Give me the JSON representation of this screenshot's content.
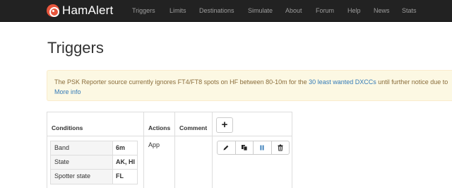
{
  "navbar": {
    "brand": "HamAlert",
    "items": [
      "Triggers",
      "Limits",
      "Destinations",
      "Simulate",
      "About",
      "Forum",
      "Help",
      "News",
      "Stats"
    ]
  },
  "page": {
    "title": "Triggers"
  },
  "alert": {
    "text_before": "The PSK Reporter source currently ignores FT4/FT8 spots on HF between 80-10m for the ",
    "link_text": "30 least wanted DXCCs",
    "text_after": " until further notice due to",
    "more_info": "More info"
  },
  "table": {
    "headers": {
      "conditions": "Conditions",
      "actions": "Actions",
      "comment": "Comment"
    },
    "add_label": "+",
    "rows": [
      {
        "conditions": [
          {
            "key": "Band",
            "value": "6m"
          },
          {
            "key": "State",
            "value": "AK, HI"
          },
          {
            "key": "Spotter state",
            "value": "FL"
          }
        ],
        "action": "App",
        "comment": ""
      }
    ]
  },
  "icons": {
    "brand": "hamalert-logo-icon",
    "add": "plus-icon",
    "edit": "pencil-icon",
    "copy": "copy-icon",
    "pause": "pause-icon",
    "delete": "trash-icon"
  },
  "colors": {
    "navbar_bg": "#222222",
    "nav_text": "#9d9d9d",
    "brand_accent": "#e8553c",
    "alert_bg": "#fcf8e3",
    "alert_text": "#8a6d3b",
    "link": "#337ab7",
    "pause_icon": "#337ab7"
  }
}
